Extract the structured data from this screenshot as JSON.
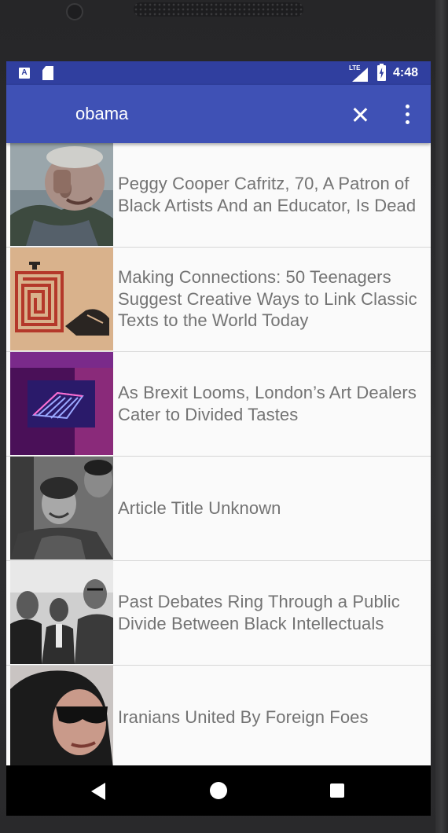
{
  "status_bar": {
    "network_label": "LTE",
    "time": "4:48",
    "icons": [
      "notification-a-icon",
      "sd-card-icon",
      "lte-signal-icon",
      "battery-charging-icon"
    ]
  },
  "app_bar": {
    "search_query": "obama",
    "clear_icon": "close-icon",
    "menu_icon": "more-vert-icon",
    "color": "#3f51b5",
    "status_color": "#303f9f"
  },
  "articles": [
    {
      "title": "Peggy Cooper Cafritz, 70, A Patron of Black Artists And an Educator, Is Dead",
      "image": "woman-portrait-photo"
    },
    {
      "title": "Making Connections: 50 Teenagers Suggest Creative Ways to Link Classic Texts to the World Today",
      "image": "maze-illustration"
    },
    {
      "title": "As Brexit Looms, London’s Art Dealers Cater to Divided Tastes",
      "image": "neon-art-photo"
    },
    {
      "title": "Article Title Unknown",
      "image": "crowd-photo"
    },
    {
      "title": "Past Debates Ring Through a Public Divide Between Black Intellectuals",
      "image": "historic-men-photo"
    },
    {
      "title": "Iranians United By Foreign Foes",
      "image": "woman-sunglasses-photo"
    }
  ],
  "text_color": "#737373",
  "nav_bar": {
    "icons": [
      "back-icon",
      "home-icon",
      "recents-icon"
    ]
  }
}
